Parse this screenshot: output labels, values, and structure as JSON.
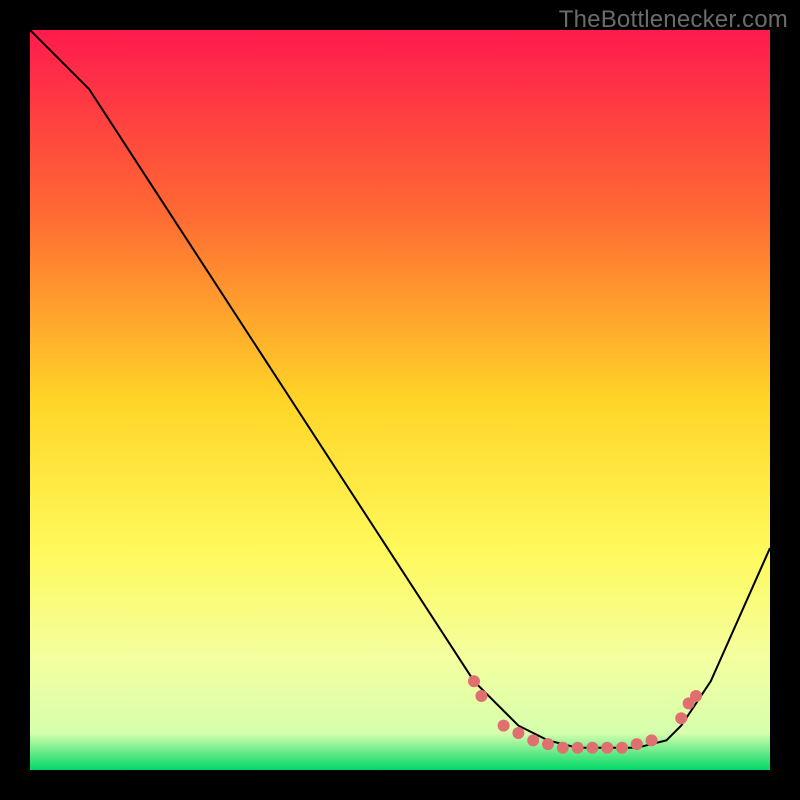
{
  "watermark": "TheBottlenecker.com",
  "chart_data": {
    "type": "line",
    "title": "",
    "xlabel": "",
    "ylabel": "",
    "xlim": [
      0,
      100
    ],
    "ylim": [
      0,
      100
    ],
    "background_gradient": {
      "stops": [
        {
          "offset": 0,
          "color": "#ff1a4d"
        },
        {
          "offset": 25,
          "color": "#ff6a33"
        },
        {
          "offset": 50,
          "color": "#ffd527"
        },
        {
          "offset": 70,
          "color": "#fff95a"
        },
        {
          "offset": 85,
          "color": "#f4ffa0"
        },
        {
          "offset": 95,
          "color": "#d6ffad"
        },
        {
          "offset": 100,
          "color": "#00d867"
        }
      ]
    },
    "series": [
      {
        "name": "bottleneck-curve",
        "color": "#000000",
        "stroke_width": 2,
        "x": [
          0,
          3,
          8,
          60,
          63,
          66,
          70,
          74,
          78,
          82,
          86,
          88,
          90,
          92,
          100
        ],
        "values": [
          100,
          97,
          92,
          12,
          9,
          6,
          4,
          3,
          3,
          3,
          4,
          6,
          9,
          12,
          30
        ]
      }
    ],
    "markers": {
      "color": "#e07070",
      "radius": 6,
      "points": [
        {
          "x": 60,
          "y": 12
        },
        {
          "x": 61,
          "y": 10
        },
        {
          "x": 64,
          "y": 6
        },
        {
          "x": 66,
          "y": 5
        },
        {
          "x": 68,
          "y": 4
        },
        {
          "x": 70,
          "y": 3.5
        },
        {
          "x": 72,
          "y": 3
        },
        {
          "x": 74,
          "y": 3
        },
        {
          "x": 76,
          "y": 3
        },
        {
          "x": 78,
          "y": 3
        },
        {
          "x": 80,
          "y": 3
        },
        {
          "x": 82,
          "y": 3.5
        },
        {
          "x": 84,
          "y": 4
        },
        {
          "x": 88,
          "y": 7
        },
        {
          "x": 89,
          "y": 9
        },
        {
          "x": 90,
          "y": 10
        }
      ]
    }
  }
}
